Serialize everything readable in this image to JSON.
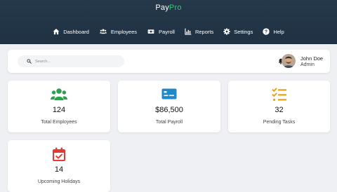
{
  "brand": {
    "part1": "Pay",
    "part2": "Pro"
  },
  "nav": [
    {
      "label": "Dashboard",
      "icon": "home-icon"
    },
    {
      "label": "Employees",
      "icon": "users-icon"
    },
    {
      "label": "Payroll",
      "icon": "money-icon"
    },
    {
      "label": "Reports",
      "icon": "chart-icon"
    },
    {
      "label": "Settings",
      "icon": "gear-icon"
    },
    {
      "label": "Help",
      "icon": "help-icon"
    }
  ],
  "search": {
    "placeholder": "Search..."
  },
  "user": {
    "name": "John Doe",
    "role": "Admin"
  },
  "stats": [
    {
      "value": "124",
      "label": "Total Employees",
      "icon": "users-icon",
      "color": "#2e9e4f"
    },
    {
      "value": "$86,500",
      "label": "Total Payroll",
      "icon": "credit-card-icon",
      "color": "#1e88c8"
    },
    {
      "value": "32",
      "label": "Pending Tasks",
      "icon": "task-list-icon",
      "color": "#e6a117"
    },
    {
      "value": "14",
      "label": "Upcoming Holidays",
      "icon": "calendar-check-icon",
      "color": "#e53935"
    }
  ],
  "colors": {
    "header_bg": "#24384a",
    "brand_accent": "#2ecc71",
    "page_bg": "#eef0f3"
  }
}
